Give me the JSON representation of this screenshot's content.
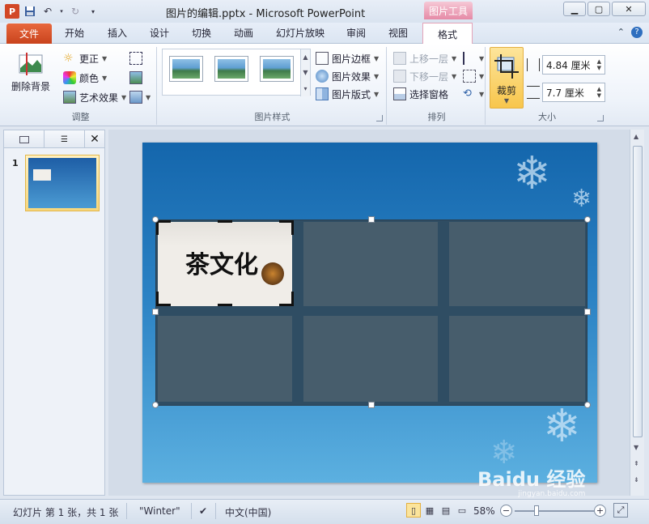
{
  "app": {
    "window_title": "图片的编辑.pptx - Microsoft PowerPoint",
    "context_tab_group": "图片工具"
  },
  "tabs": {
    "file": "文件",
    "items": [
      "开始",
      "插入",
      "设计",
      "切换",
      "动画",
      "幻灯片放映",
      "审阅",
      "视图"
    ],
    "format": "格式"
  },
  "ribbon": {
    "adjust": {
      "label": "调整",
      "remove_bg": "删除背景",
      "corrections": "更正",
      "color": "颜色",
      "artistic": "艺术效果"
    },
    "styles": {
      "label": "图片样式",
      "border": "图片边框",
      "effects": "图片效果",
      "layout": "图片版式"
    },
    "arrange": {
      "label": "排列",
      "bring_forward": "上移一层",
      "send_backward": "下移一层",
      "selection_pane": "选择窗格"
    },
    "size": {
      "label": "大小",
      "crop": "裁剪",
      "height": "4.84 厘米",
      "width": "7.7 厘米"
    }
  },
  "slides_pane": {
    "slide_number": "1"
  },
  "slide_content": {
    "tea_title": "茶文化",
    "tea_sub": "化"
  },
  "status": {
    "slide_info": "幻灯片 第 1 张，共 1 张",
    "theme": "\"Winter\"",
    "language": "中文(中国)",
    "zoom": "58%"
  },
  "watermark": {
    "brand": "Baidu 经验",
    "url": "jingyan.baidu.com"
  }
}
